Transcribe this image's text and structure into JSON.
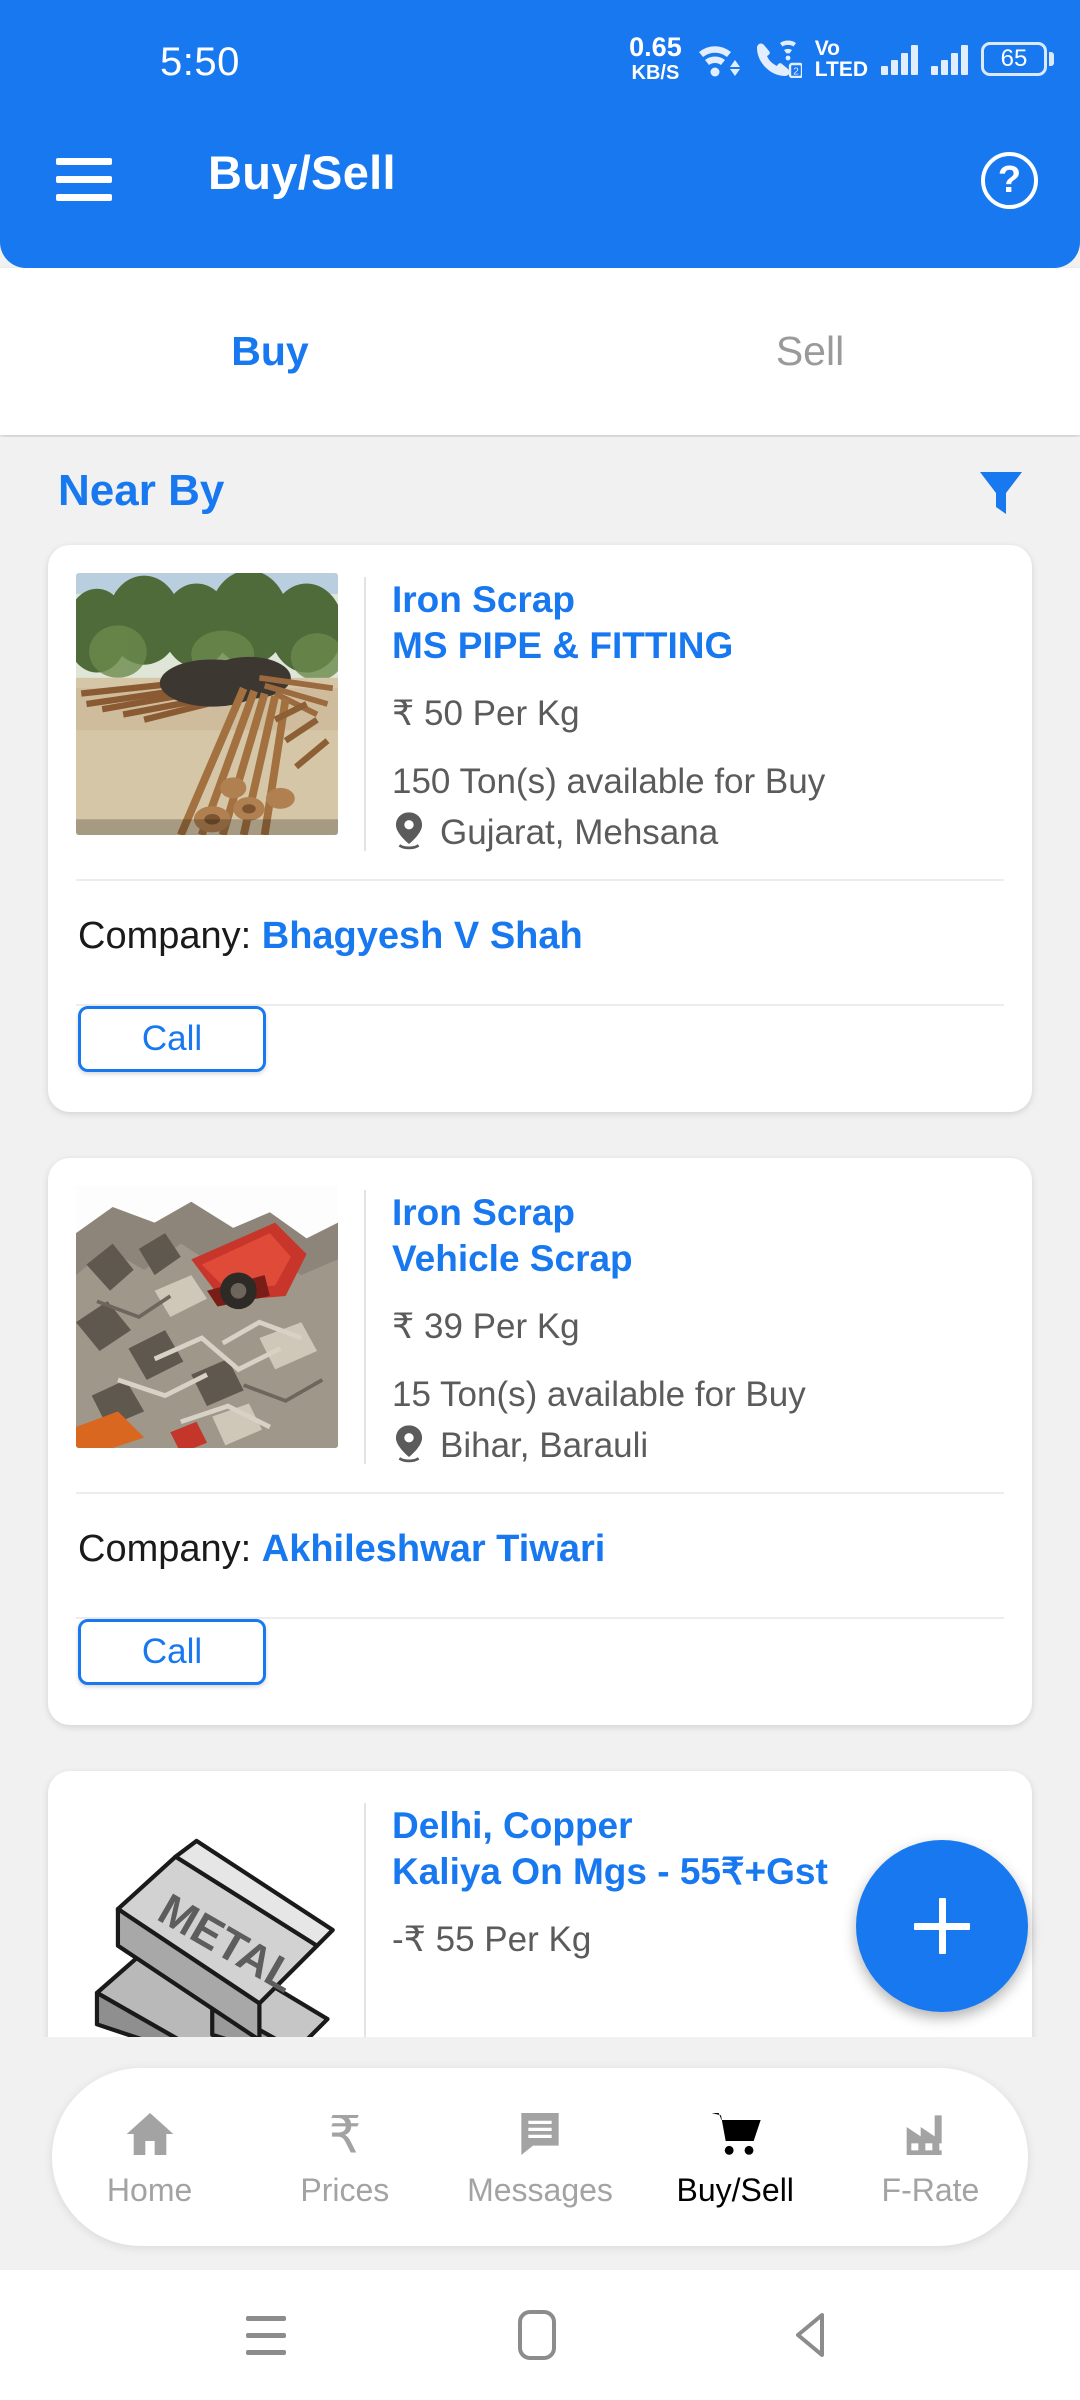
{
  "statusbar": {
    "time": "5:50",
    "net_speed_value": "0.65",
    "net_speed_unit": "KB/S",
    "wifi_icon": "wifi-icon",
    "call_wifi_icon": "wifi-calling-sim2-icon",
    "volte_line1": "Vo",
    "volte_line2": "LTED",
    "signal1_icon": "signal-bars-sim1-icon",
    "signal2_icon": "signal-bars-sim2-icon",
    "battery_level": "65"
  },
  "appbar": {
    "menu_icon": "hamburger-menu-icon",
    "title": "Buy/Sell",
    "help_icon": "help-circle-icon",
    "help_glyph": "?"
  },
  "tabs": [
    {
      "label": "Buy",
      "active": true
    },
    {
      "label": "Sell",
      "active": false
    }
  ],
  "section": {
    "title": "Near By",
    "filter_icon": "filter-funnel-icon"
  },
  "listings": [
    {
      "image_name": "iron-pipes-scrap-photo",
      "category": "Iron Scrap",
      "subtitle": "MS PIPE & FITTING",
      "price": "₹ 50 Per Kg",
      "quantity": "150 Ton(s) available for Buy",
      "location_icon": "location-pin-icon",
      "location": "Gujarat, Mehsana",
      "company_label": "Company:",
      "company_name": "Bhagyesh V Shah",
      "call_label": "Call"
    },
    {
      "image_name": "vehicle-scrap-pile-photo",
      "category": "Iron Scrap",
      "subtitle": "Vehicle Scrap",
      "price": "₹ 39 Per Kg",
      "quantity": "15 Ton(s) available for Buy",
      "location_icon": "location-pin-icon",
      "location": "Bihar, Barauli",
      "company_label": "Company:",
      "company_name": "Akhileshwar Tiwari",
      "call_label": "Call"
    },
    {
      "image_name": "metal-ingots-photo",
      "category": "Delhi, Copper",
      "subtitle": "Kaliya On Mgs - 55₹+Gst",
      "price": "-₹ 55 Per Kg"
    }
  ],
  "fab": {
    "icon": "plus-icon",
    "color": "#1878f0"
  },
  "bottomnav": [
    {
      "icon": "home-icon",
      "label": "Home",
      "active": false
    },
    {
      "icon": "rupee-icon",
      "label": "Prices",
      "active": false
    },
    {
      "icon": "message-icon",
      "label": "Messages",
      "active": false
    },
    {
      "icon": "shopping-cart-icon",
      "label": "Buy/Sell",
      "active": true
    },
    {
      "icon": "factory-icon",
      "label": "F-Rate",
      "active": false
    }
  ],
  "sysnav": {
    "recents_icon": "recents-icon",
    "home_icon": "home-pill-icon",
    "back_icon": "back-triangle-icon"
  },
  "colors": {
    "primary": "#1878f0",
    "background": "#f1f1f1",
    "card": "#ffffff",
    "muted_text": "#5b5b5b",
    "inactive": "#a3a3a3"
  }
}
